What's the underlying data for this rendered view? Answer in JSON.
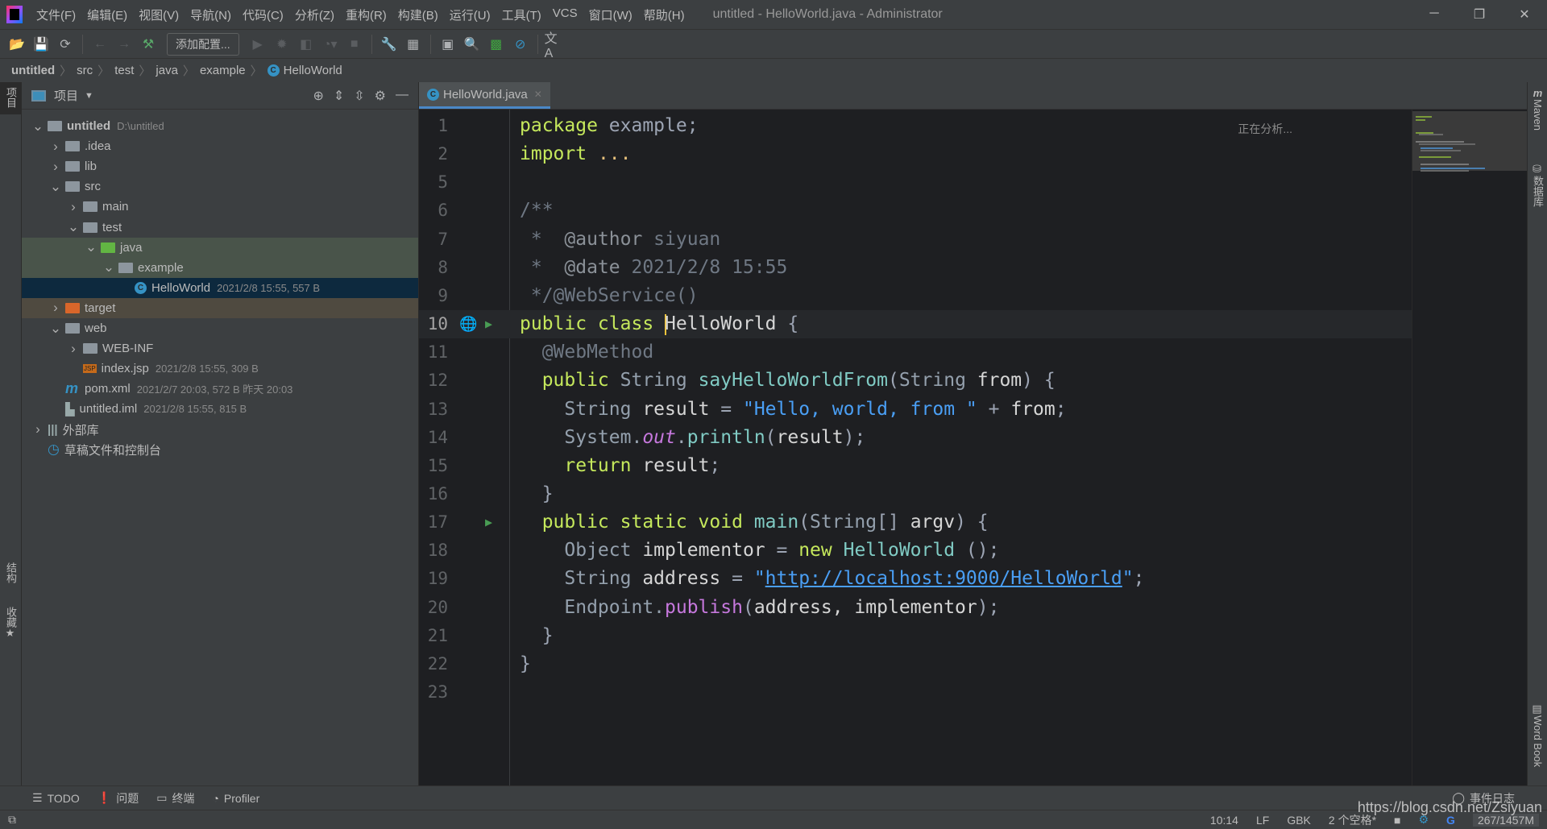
{
  "menu": [
    "文件(F)",
    "编辑(E)",
    "视图(V)",
    "导航(N)",
    "代码(C)",
    "分析(Z)",
    "重构(R)",
    "构建(B)",
    "运行(U)",
    "工具(T)",
    "VCS",
    "窗口(W)",
    "帮助(H)"
  ],
  "window_title": "untitled - HelloWorld.java - Administrator",
  "toolbar": {
    "add_config": "添加配置..."
  },
  "breadcrumb": [
    "untitled",
    "src",
    "test",
    "java",
    "example",
    "HelloWorld"
  ],
  "left_strip": {
    "project": "项目",
    "structure": "结构",
    "favorites": "收藏"
  },
  "project": {
    "title": "项目",
    "tree": [
      {
        "label": "untitled",
        "meta": "D:\\untitled",
        "depth": 0,
        "arrow": "v",
        "icon": "module",
        "bold": true
      },
      {
        "label": ".idea",
        "depth": 1,
        "arrow": ">",
        "icon": "folder"
      },
      {
        "label": "lib",
        "depth": 1,
        "arrow": ">",
        "icon": "folder"
      },
      {
        "label": "src",
        "depth": 1,
        "arrow": "v",
        "icon": "folder"
      },
      {
        "label": "main",
        "depth": 2,
        "arrow": ">",
        "icon": "folder"
      },
      {
        "label": "test",
        "depth": 2,
        "arrow": "v",
        "icon": "folder"
      },
      {
        "label": "java",
        "depth": 3,
        "arrow": "v",
        "icon": "test-folder",
        "bg": "#49544a"
      },
      {
        "label": "example",
        "depth": 4,
        "arrow": "v",
        "icon": "package",
        "bg": "#49544a"
      },
      {
        "label": "HelloWorld",
        "meta": "2021/2/8 15:55, 557 B",
        "depth": 5,
        "arrow": "",
        "icon": "class",
        "bg": "#0d293e"
      },
      {
        "label": "target",
        "depth": 1,
        "arrow": ">",
        "icon": "excluded-folder",
        "bg": "#4f4a40"
      },
      {
        "label": "web",
        "depth": 1,
        "arrow": "v",
        "icon": "web-folder"
      },
      {
        "label": "WEB-INF",
        "depth": 2,
        "arrow": ">",
        "icon": "folder"
      },
      {
        "label": "index.jsp",
        "meta": "2021/2/8 15:55, 309 B",
        "depth": 2,
        "arrow": "",
        "icon": "jsp"
      },
      {
        "label": "pom.xml",
        "meta": "2021/2/7 20:03, 572 B 昨天 20:03",
        "depth": 1,
        "arrow": "",
        "icon": "maven"
      },
      {
        "label": "untitled.iml",
        "meta": "2021/2/8 15:55, 815 B",
        "depth": 1,
        "arrow": "",
        "icon": "iml"
      },
      {
        "label": "外部库",
        "depth": 0,
        "arrow": ">",
        "icon": "library"
      },
      {
        "label": "草稿文件和控制台",
        "depth": 0,
        "arrow": "",
        "icon": "scratch"
      }
    ]
  },
  "editor": {
    "tab": "HelloWorld.java",
    "status": "正在分析...",
    "lines": [
      {
        "n": "1",
        "t": [
          [
            "kw",
            "package"
          ],
          [
            "pl",
            " example;"
          ]
        ]
      },
      {
        "n": "2",
        "t": [
          [
            "kw",
            "import"
          ],
          [
            "dot",
            " ..."
          ]
        ]
      },
      {
        "n": "5",
        "t": []
      },
      {
        "n": "6",
        "t": [
          [
            "cm",
            "/**"
          ]
        ]
      },
      {
        "n": "7",
        "t": [
          [
            "cm",
            " *  "
          ],
          [
            "an",
            "@author"
          ],
          [
            "cm",
            " siyuan"
          ]
        ]
      },
      {
        "n": "8",
        "t": [
          [
            "cm",
            " *  "
          ],
          [
            "an",
            "@date"
          ],
          [
            "cm",
            " 2021/2/8 15:55"
          ]
        ]
      },
      {
        "n": "9",
        "t": [
          [
            "cm",
            " */@WebService()"
          ]
        ]
      },
      {
        "n": "10",
        "cur": true,
        "t": [
          [
            "kw",
            "public class "
          ],
          [
            "caret",
            ""
          ],
          [
            "id",
            "HelloWorld "
          ],
          [
            "pl",
            "{"
          ]
        ]
      },
      {
        "n": "11",
        "t": [
          [
            "cm",
            "  @WebMethod"
          ]
        ]
      },
      {
        "n": "12",
        "t": [
          [
            "kw",
            "  public "
          ],
          [
            "ty",
            "String "
          ],
          [
            "fn",
            "sayHelloWorldFrom"
          ],
          [
            "pl",
            "("
          ],
          [
            "ty",
            "String "
          ],
          [
            "id",
            "from"
          ],
          [
            "pl",
            ") {"
          ]
        ]
      },
      {
        "n": "13",
        "t": [
          [
            "ty",
            "    String "
          ],
          [
            "id",
            "result "
          ],
          [
            "pl",
            "= "
          ],
          [
            "st",
            "\"Hello, world, from \""
          ],
          [
            "pl",
            " + "
          ],
          [
            "id",
            "from"
          ],
          [
            "pl",
            ";"
          ]
        ]
      },
      {
        "n": "14",
        "t": [
          [
            "ty",
            "    System."
          ],
          [
            "it",
            "out"
          ],
          [
            "pl",
            "."
          ],
          [
            "fn",
            "println"
          ],
          [
            "pl",
            "("
          ],
          [
            "id",
            "result"
          ],
          [
            "pl",
            ");"
          ]
        ]
      },
      {
        "n": "15",
        "t": [
          [
            "kw",
            "    return "
          ],
          [
            "id",
            "result"
          ],
          [
            "pl",
            ";"
          ]
        ]
      },
      {
        "n": "16",
        "t": [
          [
            "pl",
            "  }"
          ]
        ]
      },
      {
        "n": "17",
        "t": [
          [
            "kw",
            "  public static void "
          ],
          [
            "fn",
            "main"
          ],
          [
            "pl",
            "("
          ],
          [
            "ty",
            "String"
          ],
          [
            "pl",
            "[] "
          ],
          [
            "id",
            "argv"
          ],
          [
            "pl",
            ") {"
          ]
        ]
      },
      {
        "n": "18",
        "t": [
          [
            "ty",
            "    Object "
          ],
          [
            "id",
            "implementor "
          ],
          [
            "pl",
            "= "
          ],
          [
            "kw",
            "new "
          ],
          [
            "fn",
            "HelloWorld "
          ],
          [
            "pl",
            "();"
          ]
        ]
      },
      {
        "n": "19",
        "t": [
          [
            "ty",
            "    String "
          ],
          [
            "id",
            "address "
          ],
          [
            "pl",
            "= "
          ],
          [
            "st",
            "\""
          ],
          [
            "ln2",
            "http://localhost:9000/HelloWorld"
          ],
          [
            "st",
            "\""
          ],
          [
            "pl",
            ";"
          ]
        ]
      },
      {
        "n": "20",
        "t": [
          [
            "ty",
            "    Endpoint."
          ],
          [
            "pu",
            "publish"
          ],
          [
            "pl",
            "("
          ],
          [
            "id",
            "address, implementor"
          ],
          [
            "pl",
            ");"
          ]
        ]
      },
      {
        "n": "21",
        "t": [
          [
            "pl",
            "  }"
          ]
        ]
      },
      {
        "n": "22",
        "t": [
          [
            "pl",
            "}"
          ]
        ]
      },
      {
        "n": "23",
        "t": []
      }
    ]
  },
  "right_strip": {
    "maven": "Maven",
    "database": "数据库",
    "wordbook": "Word Book"
  },
  "bottom_tabs": [
    "TODO",
    "问题",
    "终端",
    "Profiler"
  ],
  "event_log": "事件日志",
  "status": {
    "position": "10:14",
    "line_sep": "LF",
    "encoding": "GBK",
    "indent": "2 个空格*",
    "memory": "267/1457M"
  },
  "watermark": "https://blog.csdn.net/Zsiyuan",
  "colors": {
    "keyword": "#c5e85c",
    "string": "#4a9ff5",
    "selection": "#0d293e",
    "accent": "#4a88c7"
  }
}
